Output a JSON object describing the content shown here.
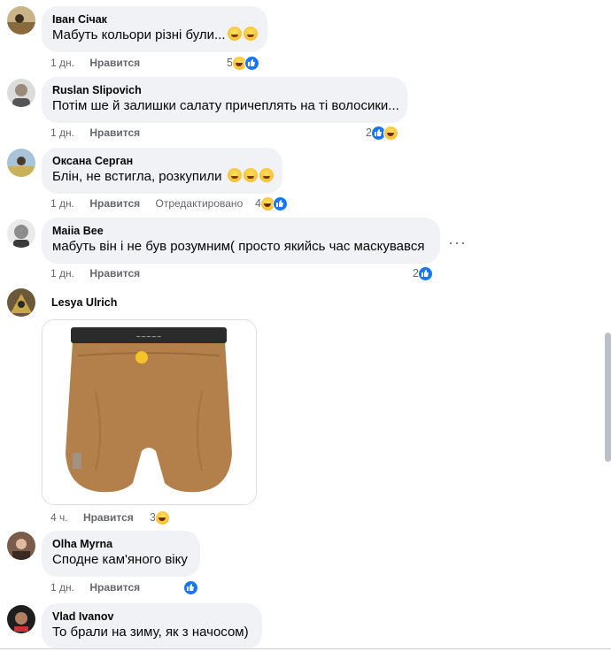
{
  "comments": [
    {
      "author": "Іван Січак",
      "text": "Мабуть кольори різні були...",
      "text_emojis": [
        "thinking-emoji",
        "laughing-emoji"
      ],
      "time": "1 дн.",
      "like_label": "Нравится",
      "reaction_count": "5",
      "reactions": [
        "haha",
        "like"
      ]
    },
    {
      "author": "Ruslan Slipovich",
      "text": "Потім ше й залишки салату причеплять на ті волосики...",
      "time": "1 дн.",
      "like_label": "Нравится",
      "reaction_count": "2",
      "reactions": [
        "like",
        "haha"
      ]
    },
    {
      "author": "Оксана Серган",
      "text": "Блін, не встигла, розкупили",
      "text_emojis": [
        "rofl-emoji",
        "rofl-emoji",
        "rofl-emoji"
      ],
      "time": "1 дн.",
      "like_label": "Нравится",
      "edited_label": "Отредактировано",
      "reaction_count": "4",
      "reactions": [
        "haha",
        "like"
      ]
    },
    {
      "author": "Maiia Bee",
      "text": "мабуть він і не був розумним( просто якийсь час маскувався",
      "time": "1 дн.",
      "like_label": "Нравится",
      "reaction_count": "2",
      "reactions": [
        "like"
      ],
      "more_label": "···"
    },
    {
      "author": "Lesya Ulrich",
      "attachment": "photo of fluffy brown boxer shorts",
      "time": "4 ч.",
      "like_label": "Нравится",
      "reaction_count": "3",
      "reactions": [
        "haha"
      ]
    },
    {
      "author": "Olha Myrna",
      "text": "Сподне кам'яного віку",
      "time": "1 дн.",
      "like_label": "Нравится",
      "reaction_count": "",
      "reactions": [
        "like"
      ]
    },
    {
      "author": "Vlad Ivanov",
      "text": "То брали на зиму, як з начосом)"
    }
  ],
  "colors": {
    "bubble": "#f0f2f5",
    "like_blue": "#1877f2",
    "meta_gray": "#65676b"
  }
}
